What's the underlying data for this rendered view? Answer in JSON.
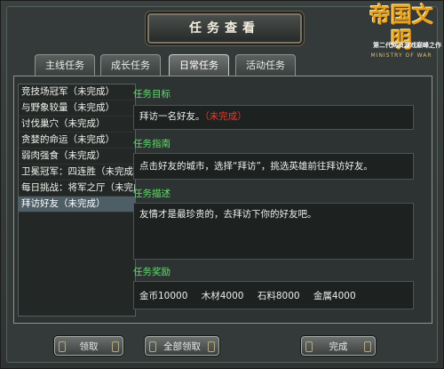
{
  "window": {
    "title": "任务查看"
  },
  "logo": {
    "main": "帝国文明",
    "sub": "MINISTRY OF WAR",
    "slogan": "第二代网页游戏巅峰之作"
  },
  "tabs": [
    {
      "label": "主线任务"
    },
    {
      "label": "成长任务"
    },
    {
      "label": "日常任务"
    },
    {
      "label": "活动任务"
    }
  ],
  "active_tab": "日常任务",
  "task_list": [
    "竞技场冠军（未完成）",
    "与野象较量（未完成）",
    "讨伐巢穴（未完成）",
    "贪婪的命运（未完成）",
    "弱肉强食（未完成）",
    "卫冕冠军：四连胜（未完成）",
    "每日挑战：将军之厅（未完成）",
    "拜访好友（未完成）"
  ],
  "selected_task": "拜访好友（未完成）",
  "detail": {
    "goal_label": "任务目标",
    "goal_text": "拜访一名好友。",
    "goal_status": "（未完成）",
    "guide_label": "任务指南",
    "guide_text": "点击好友的城市，选择“拜访”，挑选英雄前往拜访好友。",
    "desc_label": "任务描述",
    "desc_text": "友情才是最珍贵的，去拜访下你的好友吧。",
    "reward_label": "任务奖励",
    "rewards": [
      "金币10000",
      "木材4000",
      "石料8000",
      "金属4000"
    ]
  },
  "buttons": {
    "claim": "领取",
    "claim_all": "全部领取",
    "complete": "完成"
  },
  "colors": {
    "section_label": "#5fe06a",
    "status_incomplete": "#f03a2a"
  }
}
